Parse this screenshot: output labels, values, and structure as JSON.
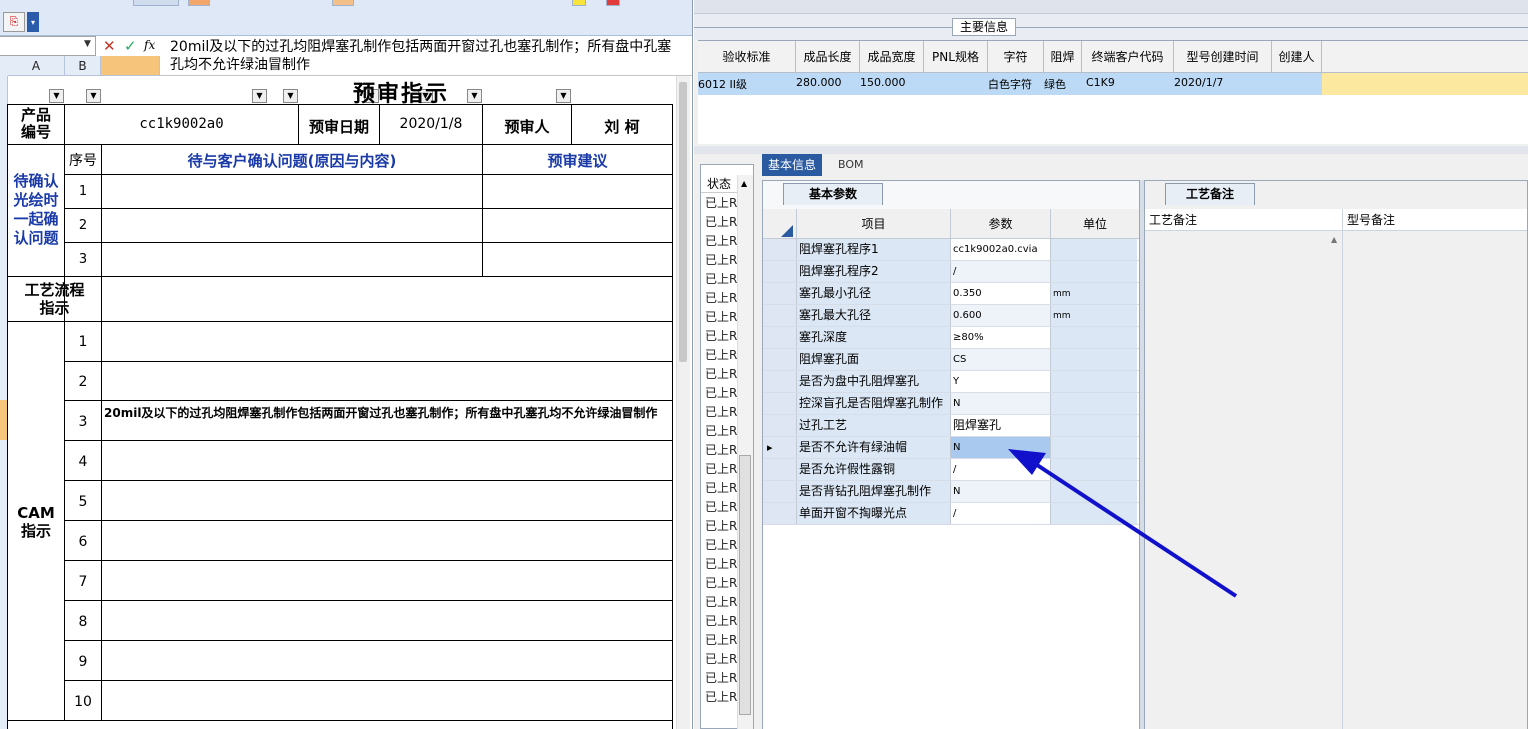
{
  "excel": {
    "formula_bar": {
      "name_box": "",
      "cancel_icon": "✕",
      "ok_icon": "✓",
      "fx_icon": "fx",
      "value": "20mil及以下的过孔均阻焊塞孔制作包括两面开窗过孔也塞孔制作；所有盘中孔塞孔均不允许绿油冒制作"
    },
    "columns": [
      "A",
      "B"
    ],
    "sheet": {
      "title": "预审指示",
      "product_no_label": "产品\n编号",
      "product_no": "cc1k9002a0",
      "review_date_label": "预审日期",
      "review_date": "2020/1/8",
      "reviewer_label": "预审人",
      "reviewer": "刘 柯",
      "confirm_section_label": "待确认\n光绘时\n一起确\n认问题",
      "seq_label": "序号",
      "issue_label": "待与客户确认问题(原因与内容)",
      "suggest_label": "预审建议",
      "confirm_rows": [
        "1",
        "2",
        "3"
      ],
      "process_label": "工艺流程\n指示",
      "cam_label": "CAM\n指示",
      "cam_rows": [
        "1",
        "2",
        "3",
        "4",
        "5",
        "6",
        "7",
        "8",
        "9",
        "10"
      ],
      "cam_row3_text": "20mil及以下的过孔均阻焊塞孔制作包括两面开窗过孔也塞孔制作；所有盘中孔塞孔均不允许绿油冒制作"
    }
  },
  "app": {
    "main_info_tab": "主要信息",
    "grid": {
      "headers": [
        "验收标准",
        "成品长度",
        "成品宽度",
        "PNL规格",
        "字符",
        "阻焊",
        "终端客户代码",
        "型号创建时间",
        "创建人"
      ],
      "row": [
        "6012 II级",
        "280.000",
        "150.000",
        "",
        "白色字符",
        "绿色",
        "C1K9",
        "2020/1/7",
        ""
      ]
    },
    "tabs": [
      "基本信息",
      "BOM"
    ],
    "status_header": "状态",
    "status_items": [
      "已上R",
      "已上R",
      "已上R",
      "已上R",
      "已上R",
      "已上R",
      "已上R",
      "已上R",
      "已上R",
      "已上R",
      "已上R",
      "已上R",
      "已上R",
      "已上R",
      "已上R",
      "已上R",
      "已上R",
      "已上R",
      "已上R",
      "已上R",
      "已上R",
      "已上R",
      "已上R",
      "已上R",
      "已上R",
      "已上R",
      "已上R"
    ],
    "params": {
      "tab": "基本参数",
      "headers": [
        "项目",
        "参数",
        "单位"
      ],
      "rows": [
        {
          "name": "阻焊塞孔程序1",
          "value": "cc1k9002a0.cvia",
          "unit": ""
        },
        {
          "name": "阻焊塞孔程序2",
          "value": "/",
          "unit": ""
        },
        {
          "name": "塞孔最小孔径",
          "value": "0.350",
          "unit": "mm"
        },
        {
          "name": "塞孔最大孔径",
          "value": "0.600",
          "unit": "mm"
        },
        {
          "name": "塞孔深度",
          "value": "≥80%",
          "unit": ""
        },
        {
          "name": "阻焊塞孔面",
          "value": "CS",
          "unit": ""
        },
        {
          "name": "是否为盘中孔阻焊塞孔",
          "value": "Y",
          "unit": ""
        },
        {
          "name": "控深盲孔是否阻焊塞孔制作",
          "value": "N",
          "unit": ""
        },
        {
          "name": "过孔工艺",
          "value": "阻焊塞孔",
          "unit": ""
        },
        {
          "name": "是否不允许有绿油帽",
          "value": "N",
          "unit": ""
        },
        {
          "name": "是否允许假性露铜",
          "value": "/",
          "unit": ""
        },
        {
          "name": "是否背钻孔阻焊塞孔制作",
          "value": "N",
          "unit": ""
        },
        {
          "name": "单面开窗不掏曝光点",
          "value": "/",
          "unit": ""
        }
      ]
    },
    "notes": {
      "tab": "工艺备注",
      "headers": [
        "工艺备注",
        "型号备注"
      ]
    },
    "accent": "#2a5a9f",
    "arrow_color": "#1111cc"
  }
}
